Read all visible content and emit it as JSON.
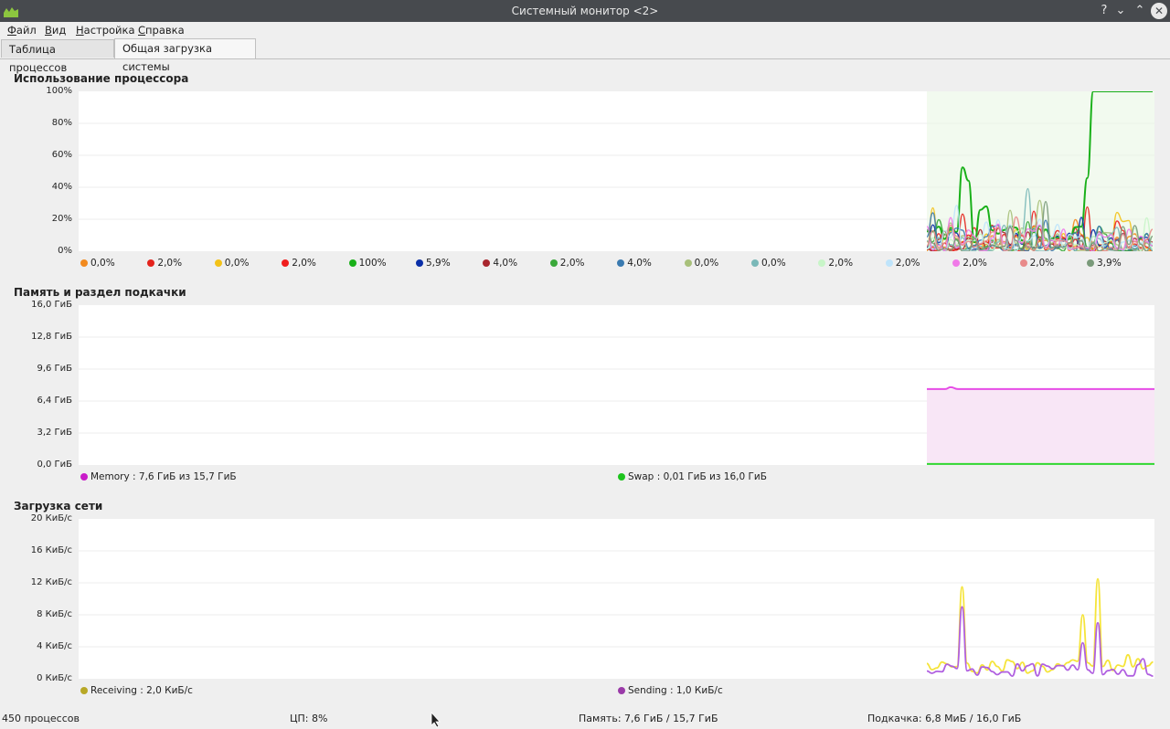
{
  "window": {
    "title": "Системный монитор <2>",
    "help_glyph": "?",
    "minimize_glyph": "⌄",
    "maximize_glyph": "⌃",
    "close_glyph": "✕"
  },
  "menu": [
    "Файл",
    "Вид",
    "Настройка",
    "Справка"
  ],
  "menu_accel": [
    "Ф",
    "В",
    "Н",
    "С"
  ],
  "tabs": [
    {
      "label": "Таблица процессов",
      "active": false
    },
    {
      "label": "Общая загрузка системы",
      "active": true
    }
  ],
  "cpu": {
    "title": "Использование процессора",
    "yticks": [
      "100%",
      "80%",
      "60%",
      "40%",
      "20%",
      "0%"
    ],
    "legend": [
      {
        "label": "0,0%",
        "color": "#f28a1e"
      },
      {
        "label": "2,0%",
        "color": "#e4231c"
      },
      {
        "label": "0,0%",
        "color": "#f3c218"
      },
      {
        "label": "2,0%",
        "color": "#f01e1e"
      },
      {
        "label": "100%",
        "color": "#19b019"
      },
      {
        "label": "5,9%",
        "color": "#0a2fa8"
      },
      {
        "label": "4,0%",
        "color": "#a8262e"
      },
      {
        "label": "2,0%",
        "color": "#3aa83a"
      },
      {
        "label": "4,0%",
        "color": "#3a7ab0"
      },
      {
        "label": "0,0%",
        "color": "#a8c07a"
      },
      {
        "label": "0,0%",
        "color": "#7ab8b8"
      },
      {
        "label": "2,0%",
        "color": "#c8f5c8"
      },
      {
        "label": "2,0%",
        "color": "#bfe4fb"
      },
      {
        "label": "2,0%",
        "color": "#f07ae8"
      },
      {
        "label": "2,0%",
        "color": "#e88a8a"
      },
      {
        "label": "3,9%",
        "color": "#7a9a7a"
      }
    ]
  },
  "memory": {
    "title": "Память и раздел подкачки",
    "yticks": [
      "16,0 ГиБ",
      "12,8 ГиБ",
      "9,6 ГиБ",
      "6,4 ГиБ",
      "3,2 ГиБ",
      "0,0 ГиБ"
    ],
    "ymax_gib": 16.0,
    "memory_gib": 7.6,
    "swap_gib": 0.01,
    "legend": [
      {
        "label": "Memory : 7,6 ГиБ из 15,7 ГиБ",
        "color": "#c91bc9"
      },
      {
        "label": "Swap : 0,01 ГиБ из 16,0 ГиБ",
        "color": "#1dc41d"
      }
    ]
  },
  "network": {
    "title": "Загрузка сети",
    "yticks": [
      "20 КиБ/с",
      "16 КиБ/с",
      "12 КиБ/с",
      "8 КиБ/с",
      "4 КиБ/с",
      "0 КиБ/с"
    ],
    "ymax": 20,
    "legend": [
      {
        "label": "Receiving : 2,0 КиБ/с",
        "color": "#b8a826"
      },
      {
        "label": "Sending : 1,0 КиБ/с",
        "color": "#9a3aa8"
      }
    ]
  },
  "status": {
    "processes": "450 процессов",
    "cpu": "ЦП: 8%",
    "memory": "Память: 7,6 ГиБ / 15,7 ГиБ",
    "swap": "Подкачка: 6,8 МиБ / 16,0 ГиБ"
  },
  "colors": {
    "titlebar": "#474a4e",
    "plot_bg": "#ffffff",
    "recent_fill": "#eaf6e5",
    "mem_fill": "#f8e6f6"
  }
}
